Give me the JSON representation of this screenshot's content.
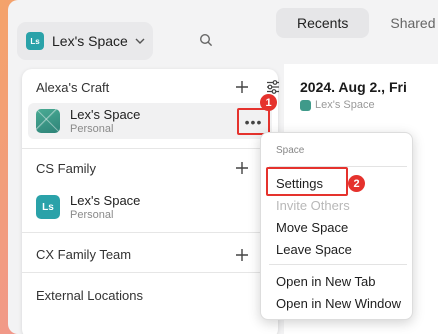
{
  "header": {
    "space_badge": "Ls",
    "space_name": "Lex's Space",
    "tabs": [
      "Recents",
      "Shared"
    ]
  },
  "document": {
    "title": "2024. Aug 2., Fri",
    "space": "Lex's Space"
  },
  "sidebar": {
    "sections": [
      {
        "title": "Alexa's Craft"
      },
      {
        "title": "CS Family"
      },
      {
        "title": "CX Family Team"
      },
      {
        "title": "External Locations"
      }
    ],
    "items": [
      {
        "title": "Lex's Space",
        "sub": "Personal"
      },
      {
        "title": "Lex's Space",
        "sub": "Personal",
        "badge": "Ls"
      }
    ],
    "more_label": "•••"
  },
  "callouts": [
    "1",
    "2"
  ],
  "menu": {
    "header": "Space",
    "items": [
      {
        "label": "Settings",
        "disabled": false
      },
      {
        "label": "Invite Others",
        "disabled": true
      },
      {
        "label": "Move Space",
        "disabled": false
      },
      {
        "label": "Leave Space",
        "disabled": false
      },
      {
        "label": "Open in New Tab",
        "disabled": false
      },
      {
        "label": "Open in New Window",
        "disabled": false
      }
    ]
  },
  "colors": {
    "accent": "#2aa2a9",
    "highlight": "#e5322d"
  },
  "icons": [
    "chevron-down-icon",
    "search-icon",
    "plus-icon",
    "sliders-icon",
    "more-icon"
  ]
}
